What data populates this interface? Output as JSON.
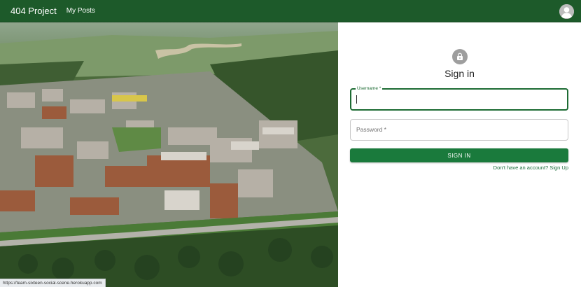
{
  "appbar": {
    "title": "404 Project",
    "nav_my_posts": "My Posts",
    "color": "#1d5a2a"
  },
  "hero": {
    "description_icon": "campus-aerial-photo"
  },
  "signin": {
    "icon": "lock-icon",
    "title": "Sign in",
    "username_label": "Username *",
    "username_value": "",
    "password_placeholder": "Password *",
    "button_label": "SIGN IN",
    "signup_link": "Don't have an account? Sign Up",
    "accent": "#1a7a3c"
  },
  "status_bar": {
    "url": "https://team-sixteen-social-scene.herokuapp.com"
  }
}
